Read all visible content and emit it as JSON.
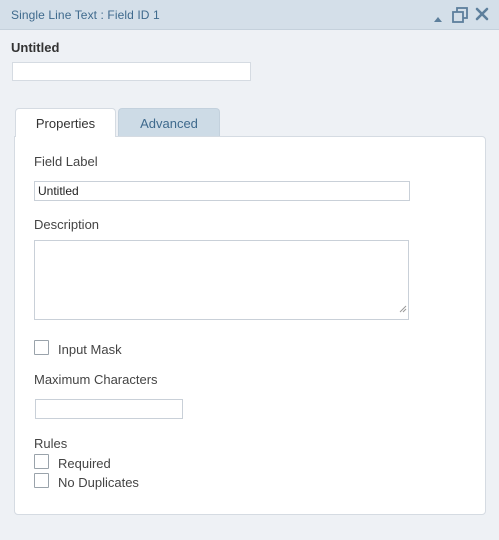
{
  "header": {
    "title": "Single Line Text : Field ID 1",
    "background": "#d4dfe9",
    "title_color": "#3f6a8d",
    "icons": [
      "collapse-icon",
      "duplicate-icon",
      "close-icon"
    ]
  },
  "field": {
    "title": "Untitled",
    "preview_value": ""
  },
  "tabs": [
    {
      "label": "Properties",
      "active": true
    },
    {
      "label": "Advanced",
      "active": false
    }
  ],
  "properties": {
    "field_label": {
      "label": "Field Label",
      "value": "Untitled"
    },
    "description": {
      "label": "Description",
      "value": ""
    },
    "input_mask": {
      "label": "Input Mask",
      "checked": false
    },
    "maximum_characters": {
      "label": "Maximum Characters",
      "value": ""
    },
    "rules": {
      "label": "Rules",
      "required": {
        "label": "Required",
        "checked": false
      },
      "no_duplicates": {
        "label": "No Duplicates",
        "checked": false
      }
    }
  }
}
